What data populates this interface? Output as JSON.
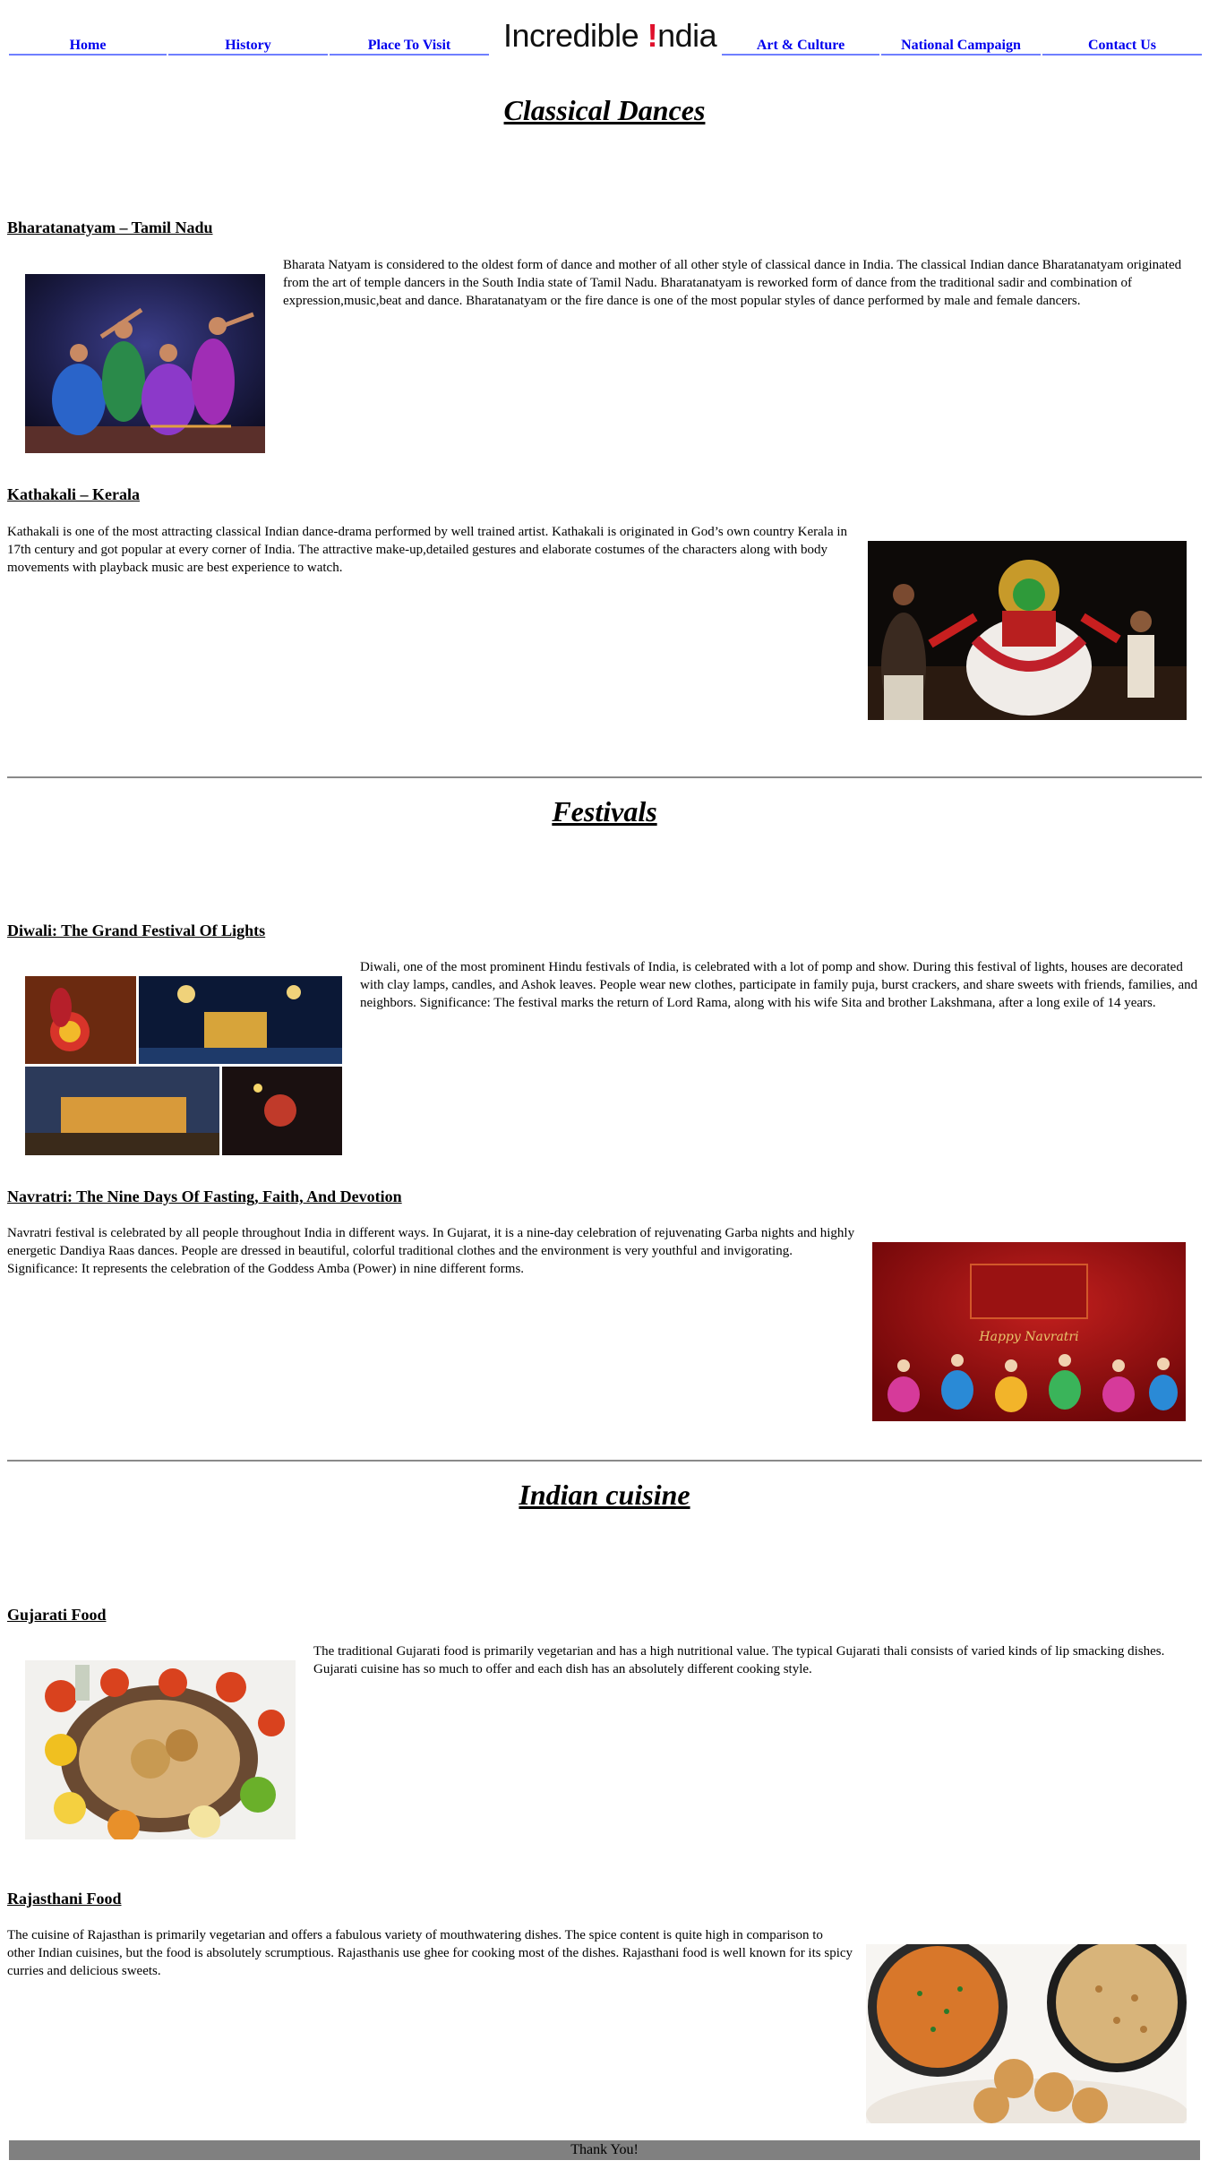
{
  "nav": {
    "items": [
      "Home",
      "History",
      "Place To Visit",
      "Art & Culture",
      "National Campaign",
      "Contact Us"
    ],
    "logo": {
      "text_before": "Incredible ",
      "accent": "!",
      "text_after": "ndia"
    }
  },
  "sections": [
    {
      "title": "Classical Dances",
      "items": [
        {
          "heading": "Bharatanatyam – Tamil Nadu",
          "text": "Bharata Natyam is considered to the oldest form of dance and mother of all other style of classical dance in India. The classical Indian dance Bharatanatyam originated from the art of temple dancers in the South India state of Tamil Nadu. Bharatanatyam is reworked form of dance from the traditional sadir and combination of expression,music,beat and dance. Bharatanatyam or the fire dance is one of the most popular styles of dance performed by male and female dancers.",
          "image": "bharatanatyam-dancers-photo"
        },
        {
          "heading": "Kathakali – Kerala",
          "text": "Kathakali is one of the most attracting classical Indian dance-drama performed by well trained artist. Kathakali is originated in God’s own country Kerala in 17th century and got popular at every corner of India. The attractive make-up,detailed gestures and elaborate costumes of the characters along with body movements with playback music are best experience to watch.",
          "image": "kathakali-performer-photo"
        }
      ]
    },
    {
      "title": "Festivals",
      "items": [
        {
          "heading": "Diwali: The Grand Festival Of Lights",
          "text": "Diwali, one of the most prominent Hindu festivals of India, is celebrated with a lot of pomp and show. During this festival of lights, houses are decorated with clay lamps, candles, and Ashok leaves. People wear new clothes, participate in family puja, burst crackers, and share sweets with friends, families, and neighbors. Significance: The festival marks the return of Lord Rama, along with his wife Sita and brother Lakshmana, after a long exile of 14 years.",
          "image": "diwali-collage-photo"
        },
        {
          "heading": "Navratri: The Nine Days Of Fasting, Faith, And Devotion",
          "text": "Navratri festival is celebrated by all people throughout India in different ways. In Gujarat, it is a nine-day celebration of rejuvenating Garba nights and highly energetic Dandiya Raas dances. People are dressed in beautiful, colorful traditional clothes and the environment is very youthful and invigorating. Significance: It represents the celebration of the Goddess Amba (Power) in nine different forms.",
          "image": "navratri-banner-image",
          "image_caption": "Happy Navratri"
        }
      ]
    },
    {
      "title": "Indian cuisine",
      "items": [
        {
          "heading": "Gujarati Food",
          "text": "The traditional Gujarati food is primarily vegetarian and has a high nutritional value. The typical Gujarati thali consists of varied kinds of lip smacking dishes. Gujarati cuisine has so much to offer and each dish has an absolutely different cooking style.",
          "image": "gujarati-thali-photo"
        },
        {
          "heading": "Rajasthani Food",
          "text": "The cuisine of Rajasthan is primarily vegetarian and offers a fabulous variety of mouthwatering dishes. The spice content is quite high in comparison to other Indian cuisines, but the food is absolutely scrumptious. Rajasthanis use ghee for cooking most of the dishes. Rajasthani food is well known for its spicy curries and delicious sweets.",
          "image": "dal-baati-photo"
        }
      ]
    }
  ],
  "footer": {
    "text": "Thank You!"
  },
  "colors": {
    "link": "#0000ee",
    "nav_underline": "#6f7fff",
    "logo_accent": "#e0102c",
    "footer_bg": "#808080"
  }
}
